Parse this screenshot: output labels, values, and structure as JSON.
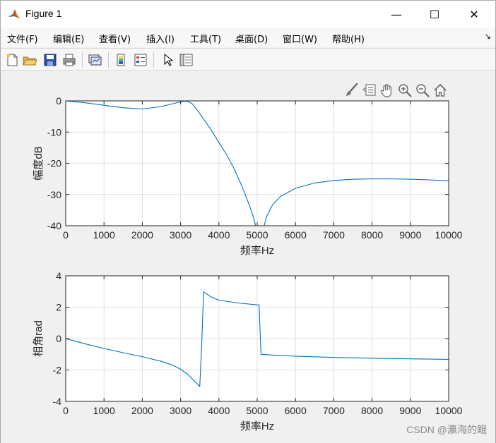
{
  "window": {
    "title": "Figure 1",
    "minimize": "—",
    "maximize": "☐",
    "close": "✕"
  },
  "menu": {
    "items": [
      "文件(F)",
      "编辑(E)",
      "查看(V)",
      "插入(I)",
      "工具(T)",
      "桌面(D)",
      "窗口(W)",
      "帮助(H)"
    ],
    "corner": "↘"
  },
  "toolbar": {
    "buttons": [
      "new-figure-icon",
      "open-file-icon",
      "save-icon",
      "print-icon",
      "link-plot-icon",
      "insert-colorbar-icon",
      "insert-legend-icon",
      "edit-plot-arrow-icon",
      "property-inspector-icon"
    ]
  },
  "axes_toolbar": [
    "brush-icon",
    "data-tips-icon",
    "pan-icon",
    "zoom-in-icon",
    "zoom-out-icon",
    "home-icon"
  ],
  "watermark": "CSDN @瀛海的鲲",
  "chart_data": [
    {
      "type": "line",
      "xlabel": "频率Hz",
      "ylabel": "幅度dB",
      "xlim": [
        0,
        10000
      ],
      "ylim": [
        -40,
        0
      ],
      "xticks": [
        0,
        1000,
        2000,
        3000,
        4000,
        5000,
        6000,
        7000,
        8000,
        9000,
        10000
      ],
      "yticks": [
        0,
        -10,
        -20,
        -30,
        -40
      ],
      "grid": true,
      "color": "#0072bd",
      "series": [
        {
          "x": [
            0,
            500,
            1000,
            1500,
            2000,
            2500,
            2800,
            3000,
            3100,
            3200,
            3300,
            3400,
            3600,
            3800,
            4000,
            4200,
            4400,
            4600,
            4800,
            4900,
            4960,
            null,
            5180,
            5250,
            5400,
            5600,
            6000,
            6500,
            7000,
            7500,
            8000,
            8500,
            9000,
            9500,
            10000
          ],
          "y": [
            0,
            -0.6,
            -1.4,
            -2.2,
            -2.6,
            -1.8,
            -0.9,
            -0.3,
            -0.1,
            -0.2,
            -0.9,
            -2.4,
            -5.8,
            -9.4,
            -13.3,
            -17.2,
            -21.8,
            -27.3,
            -33.6,
            -37.2,
            -40,
            null,
            -40,
            -37.0,
            -33.3,
            -30.7,
            -28.0,
            -26.3,
            -25.5,
            -25.1,
            -25.0,
            -25.0,
            -25.1,
            -25.3,
            -25.6
          ]
        }
      ]
    },
    {
      "type": "line",
      "xlabel": "频率Hz",
      "ylabel": "相角rad",
      "xlim": [
        0,
        10000
      ],
      "ylim": [
        -4,
        4
      ],
      "xticks": [
        0,
        1000,
        2000,
        3000,
        4000,
        5000,
        6000,
        7000,
        8000,
        9000,
        10000
      ],
      "yticks": [
        4,
        2,
        0,
        -2,
        -4
      ],
      "grid": true,
      "color": "#0072bd",
      "series": [
        {
          "x": [
            0,
            500,
            1000,
            1500,
            2000,
            2500,
            2800,
            3000,
            3200,
            3400,
            3500,
            3550,
            3600,
            3800,
            4000,
            4500,
            5000,
            5050,
            5100,
            5500,
            6000,
            7000,
            8000,
            9000,
            10000
          ],
          "y": [
            0,
            -0.33,
            -0.63,
            -0.9,
            -1.15,
            -1.45,
            -1.7,
            -1.95,
            -2.3,
            -2.8,
            -3.05,
            -0.5,
            2.98,
            2.65,
            2.45,
            2.27,
            2.15,
            2.15,
            -1.0,
            -1.06,
            -1.12,
            -1.2,
            -1.25,
            -1.29,
            -1.32
          ]
        }
      ]
    }
  ]
}
